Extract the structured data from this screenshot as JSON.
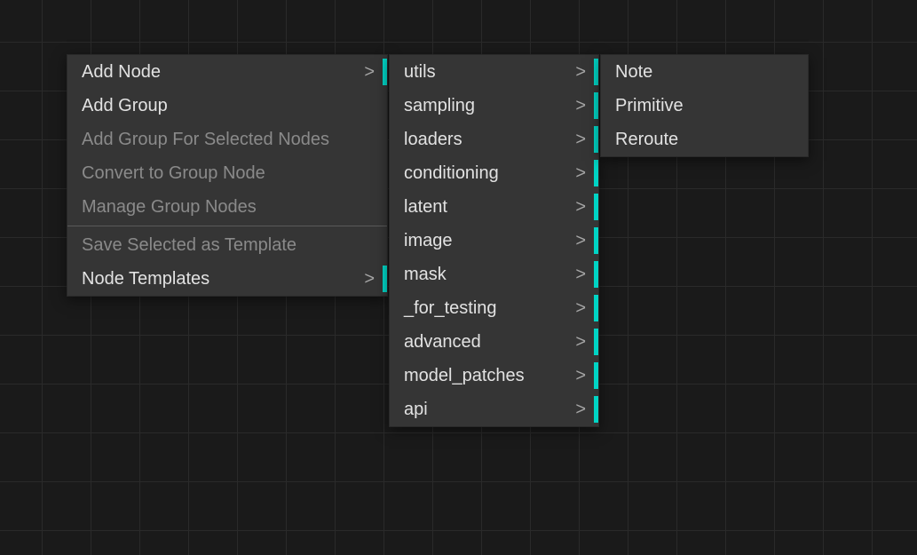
{
  "menus": {
    "main": {
      "items": [
        {
          "label": "Add Node",
          "has_submenu": true,
          "enabled": true,
          "accent": true
        },
        {
          "label": "Add Group",
          "has_submenu": false,
          "enabled": true,
          "accent": false
        },
        {
          "label": "Add Group For Selected Nodes",
          "has_submenu": false,
          "enabled": false,
          "accent": false
        },
        {
          "label": "Convert to Group Node",
          "has_submenu": false,
          "enabled": false,
          "accent": false
        },
        {
          "label": "Manage Group Nodes",
          "has_submenu": false,
          "enabled": false,
          "accent": false
        }
      ],
      "items2": [
        {
          "label": "Save Selected as Template",
          "has_submenu": false,
          "enabled": false,
          "accent": false
        },
        {
          "label": "Node Templates",
          "has_submenu": true,
          "enabled": true,
          "accent": true
        }
      ]
    },
    "sub1": {
      "items": [
        {
          "label": "utils",
          "has_submenu": true,
          "accent": true
        },
        {
          "label": "sampling",
          "has_submenu": true,
          "accent": true
        },
        {
          "label": "loaders",
          "has_submenu": true,
          "accent": true
        },
        {
          "label": "conditioning",
          "has_submenu": true,
          "accent": true
        },
        {
          "label": "latent",
          "has_submenu": true,
          "accent": true
        },
        {
          "label": "image",
          "has_submenu": true,
          "accent": true
        },
        {
          "label": "mask",
          "has_submenu": true,
          "accent": true
        },
        {
          "label": "_for_testing",
          "has_submenu": true,
          "accent": true
        },
        {
          "label": "advanced",
          "has_submenu": true,
          "accent": true
        },
        {
          "label": "model_patches",
          "has_submenu": true,
          "accent": true
        },
        {
          "label": "api",
          "has_submenu": true,
          "accent": true
        }
      ]
    },
    "sub2": {
      "items": [
        {
          "label": "Note"
        },
        {
          "label": "Primitive"
        },
        {
          "label": "Reroute"
        }
      ]
    }
  }
}
